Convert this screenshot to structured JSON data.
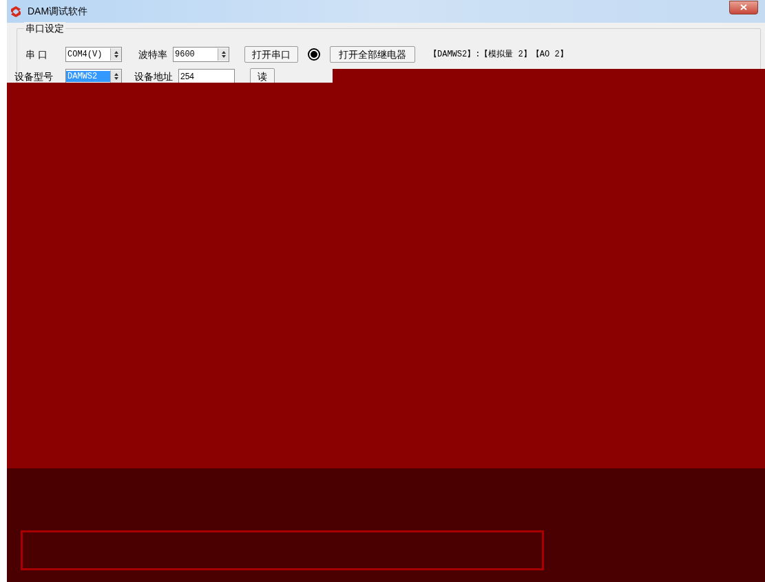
{
  "window": {
    "title": "DAM调试软件"
  },
  "group": {
    "title": "串口设定"
  },
  "row_1": {
    "port_label": "串 口",
    "port_value": "COM4(V)",
    "baud_label": "波特率",
    "baud_value": "9600",
    "open_button": "打开串口",
    "indicator_on": true,
    "relays_button": "打开全部继电器",
    "device_info": "【DAMWS2】:【模拟量 2】【AO 2】"
  },
  "row_2": {
    "model_label": "设备型号",
    "model_value": "DAMWS2",
    "model_selected": true,
    "address_label": "设备地址",
    "address_value": "254",
    "read_button": "读"
  },
  "output_box": {
    "kind": "empty"
  }
}
